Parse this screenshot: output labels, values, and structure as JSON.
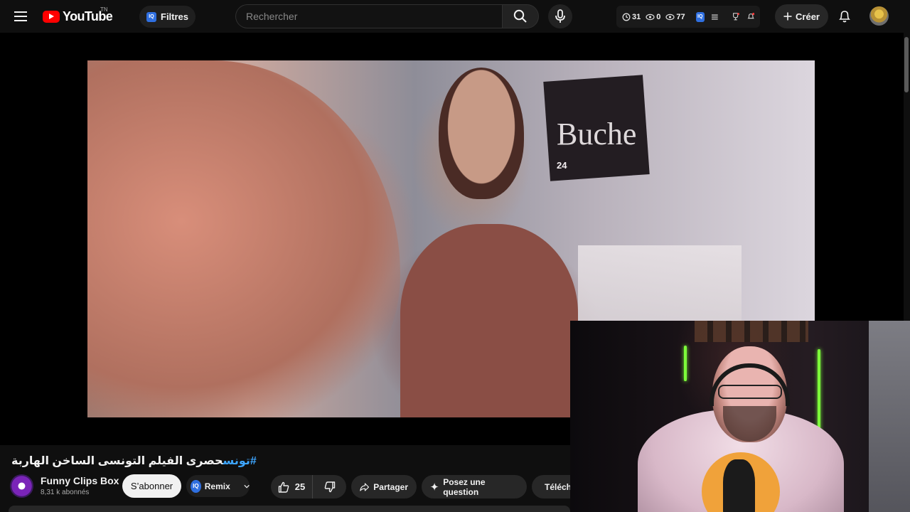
{
  "header": {
    "logo_text": "YouTube",
    "logo_region": "TN",
    "filters_badge": "IQ",
    "filters_label": "Filtres",
    "search_placeholder": "Rechercher",
    "stats": {
      "time_count": "31",
      "eye_count_1": "0",
      "eye_count_2": "77",
      "iq_badge": "IQ"
    },
    "create_label": "Créer"
  },
  "video": {
    "frame_box_text": "Buche",
    "frame_box_num": "24",
    "title_hashtag": "#تونس",
    "title_text": "حصرى الفيلم التونسى الساخن الهاربة"
  },
  "channel": {
    "name": "Funny Clips Box",
    "subscribers": "8,31 k abonnés",
    "subscribe_label": "S’abonner"
  },
  "actions": {
    "remix_badge": "IQ",
    "remix_label": "Remix",
    "like_count": "25",
    "share_label": "Partager",
    "ask_label": "Posez une question",
    "download_label": "Télécharger"
  },
  "colors": {
    "brand_red": "#ff0000",
    "link_blue": "#3ea6ff",
    "iq_blue": "#2f6fe0"
  }
}
